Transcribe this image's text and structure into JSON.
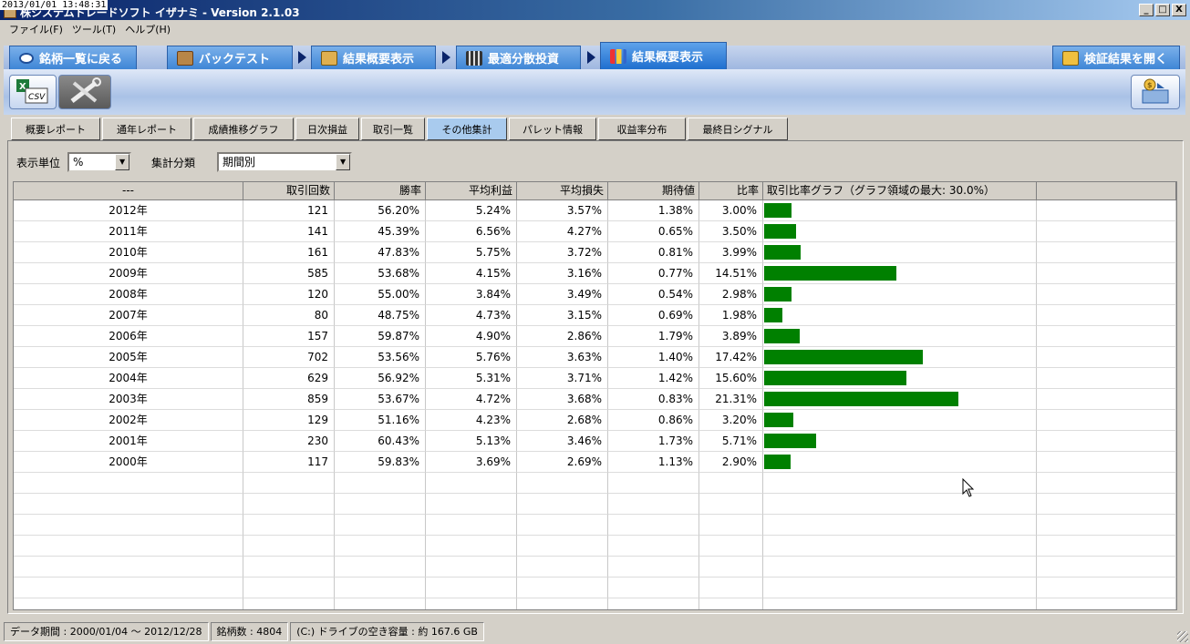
{
  "window": {
    "timestamp": "2013/01/01 13:48:31",
    "title": "株システムトレードソフト イザナミ - Version 2.1.03",
    "controls": [
      "_",
      "□",
      "X"
    ]
  },
  "menu": [
    "ファイル(F)",
    "ツール(T)",
    "ヘルプ(H)"
  ],
  "nav": {
    "tabs": [
      {
        "label": "銘柄一覧に戻る",
        "icon": "eye-icon"
      },
      {
        "label": "バックテスト",
        "icon": "bag-icon"
      },
      {
        "label": "結果概要表示",
        "icon": "money-bag-icon"
      },
      {
        "label": "最適分散投資",
        "icon": "calculator-icon"
      },
      {
        "label": "結果概要表示",
        "icon": "bar-chart-icon"
      }
    ],
    "open_results": "検証結果を開く"
  },
  "toolbar": {
    "csv_label": "CSV"
  },
  "subtabs": [
    "概要レポート",
    "通年レポート",
    "成績推移グラフ",
    "日次損益",
    "取引一覧",
    "その他集計",
    "パレット情報",
    "収益率分布",
    "最終日シグナル"
  ],
  "filters": {
    "unit_label": "表示単位",
    "unit_value": "%",
    "category_label": "集計分類",
    "category_value": "期間別"
  },
  "table": {
    "headers": [
      "---",
      "取引回数",
      "勝率",
      "平均利益",
      "平均損失",
      "期待値",
      "比率",
      "取引比率グラフ（グラフ領域の最大: 30.0%）"
    ],
    "graph_max_percent": 30.0,
    "rows": [
      {
        "period": "2012年",
        "trades": "121",
        "win": "56.20%",
        "avg_profit": "5.24%",
        "avg_loss": "3.57%",
        "expected": "1.38%",
        "ratio": "3.00%",
        "ratio_value": 3.0
      },
      {
        "period": "2011年",
        "trades": "141",
        "win": "45.39%",
        "avg_profit": "6.56%",
        "avg_loss": "4.27%",
        "expected": "0.65%",
        "ratio": "3.50%",
        "ratio_value": 3.5
      },
      {
        "period": "2010年",
        "trades": "161",
        "win": "47.83%",
        "avg_profit": "5.75%",
        "avg_loss": "3.72%",
        "expected": "0.81%",
        "ratio": "3.99%",
        "ratio_value": 3.99
      },
      {
        "period": "2009年",
        "trades": "585",
        "win": "53.68%",
        "avg_profit": "4.15%",
        "avg_loss": "3.16%",
        "expected": "0.77%",
        "ratio": "14.51%",
        "ratio_value": 14.51
      },
      {
        "period": "2008年",
        "trades": "120",
        "win": "55.00%",
        "avg_profit": "3.84%",
        "avg_loss": "3.49%",
        "expected": "0.54%",
        "ratio": "2.98%",
        "ratio_value": 2.98
      },
      {
        "period": "2007年",
        "trades": "80",
        "win": "48.75%",
        "avg_profit": "4.73%",
        "avg_loss": "3.15%",
        "expected": "0.69%",
        "ratio": "1.98%",
        "ratio_value": 1.98
      },
      {
        "period": "2006年",
        "trades": "157",
        "win": "59.87%",
        "avg_profit": "4.90%",
        "avg_loss": "2.86%",
        "expected": "1.79%",
        "ratio": "3.89%",
        "ratio_value": 3.89
      },
      {
        "period": "2005年",
        "trades": "702",
        "win": "53.56%",
        "avg_profit": "5.76%",
        "avg_loss": "3.63%",
        "expected": "1.40%",
        "ratio": "17.42%",
        "ratio_value": 17.42
      },
      {
        "period": "2004年",
        "trades": "629",
        "win": "56.92%",
        "avg_profit": "5.31%",
        "avg_loss": "3.71%",
        "expected": "1.42%",
        "ratio": "15.60%",
        "ratio_value": 15.6
      },
      {
        "period": "2003年",
        "trades": "859",
        "win": "53.67%",
        "avg_profit": "4.72%",
        "avg_loss": "3.68%",
        "expected": "0.83%",
        "ratio": "21.31%",
        "ratio_value": 21.31
      },
      {
        "period": "2002年",
        "trades": "129",
        "win": "51.16%",
        "avg_profit": "4.23%",
        "avg_loss": "2.68%",
        "expected": "0.86%",
        "ratio": "3.20%",
        "ratio_value": 3.2
      },
      {
        "period": "2001年",
        "trades": "230",
        "win": "60.43%",
        "avg_profit": "5.13%",
        "avg_loss": "3.46%",
        "expected": "1.73%",
        "ratio": "5.71%",
        "ratio_value": 5.71
      },
      {
        "period": "2000年",
        "trades": "117",
        "win": "59.83%",
        "avg_profit": "3.69%",
        "avg_loss": "2.69%",
        "expected": "1.13%",
        "ratio": "2.90%",
        "ratio_value": 2.9
      }
    ]
  },
  "status": {
    "period": "データ期間 : 2000/01/04 〜 2012/12/28",
    "count": "銘柄数 : 4804",
    "disk": "(C:) ドライブの空き容量 : 約 167.6 GB"
  },
  "colors": {
    "bar": "#008000",
    "nav_tab": "#3f86d6",
    "active_subtab": "#a9cbee"
  }
}
